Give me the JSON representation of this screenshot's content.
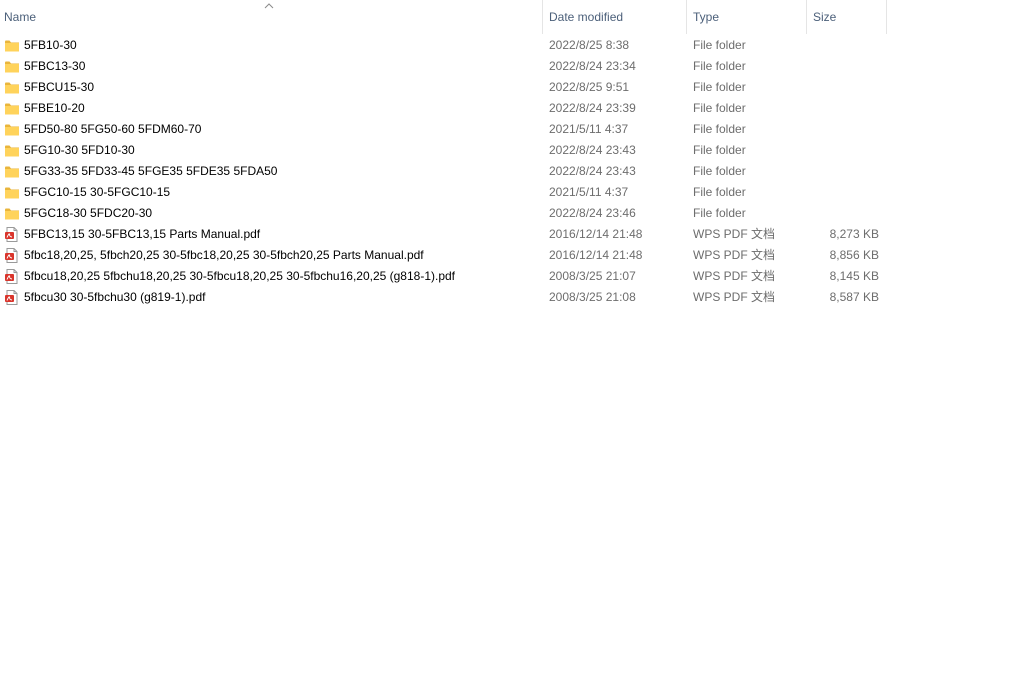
{
  "columns": {
    "name": "Name",
    "date": "Date modified",
    "type": "Type",
    "size": "Size"
  },
  "rows": [
    {
      "kind": "folder",
      "name": "5FB10-30",
      "date": "2022/8/25 8:38",
      "type": "File folder",
      "size": ""
    },
    {
      "kind": "folder",
      "name": "5FBC13-30",
      "date": "2022/8/24 23:34",
      "type": "File folder",
      "size": ""
    },
    {
      "kind": "folder",
      "name": "5FBCU15-30",
      "date": "2022/8/25 9:51",
      "type": "File folder",
      "size": ""
    },
    {
      "kind": "folder",
      "name": "5FBE10-20",
      "date": "2022/8/24 23:39",
      "type": "File folder",
      "size": ""
    },
    {
      "kind": "folder",
      "name": "5FD50-80 5FG50-60 5FDM60-70",
      "date": "2021/5/11 4:37",
      "type": "File folder",
      "size": ""
    },
    {
      "kind": "folder",
      "name": "5FG10-30 5FD10-30",
      "date": "2022/8/24 23:43",
      "type": "File folder",
      "size": ""
    },
    {
      "kind": "folder",
      "name": "5FG33-35 5FD33-45 5FGE35 5FDE35 5FDA50",
      "date": "2022/8/24 23:43",
      "type": "File folder",
      "size": ""
    },
    {
      "kind": "folder",
      "name": "5FGC10-15 30-5FGC10-15",
      "date": "2021/5/11 4:37",
      "type": "File folder",
      "size": ""
    },
    {
      "kind": "folder",
      "name": "5FGC18-30 5FDC20-30",
      "date": "2022/8/24 23:46",
      "type": "File folder",
      "size": ""
    },
    {
      "kind": "pdf",
      "name": "5FBC13,15 30-5FBC13,15 Parts Manual.pdf",
      "date": "2016/12/14 21:48",
      "type": "WPS PDF 文档",
      "size": "8,273 KB"
    },
    {
      "kind": "pdf",
      "name": "5fbc18,20,25, 5fbch20,25 30-5fbc18,20,25 30-5fbch20,25 Parts Manual.pdf",
      "date": "2016/12/14 21:48",
      "type": "WPS PDF 文档",
      "size": "8,856 KB"
    },
    {
      "kind": "pdf",
      "name": "5fbcu18,20,25 5fbchu18,20,25 30-5fbcu18,20,25 30-5fbchu16,20,25 (g818-1).pdf",
      "date": "2008/3/25 21:07",
      "type": "WPS PDF 文档",
      "size": "8,145 KB"
    },
    {
      "kind": "pdf",
      "name": "5fbcu30 30-5fbchu30 (g819-1).pdf",
      "date": "2008/3/25 21:08",
      "type": "WPS PDF 文档",
      "size": "8,587 KB"
    }
  ],
  "icons": {
    "folder": "folder-icon",
    "pdf": "pdf-file-icon",
    "sort": "sort-ascending-icon"
  },
  "colors": {
    "header_text": "#4c607a",
    "folder_fill": "#ffd35b",
    "pdf_red": "#d9342b"
  }
}
